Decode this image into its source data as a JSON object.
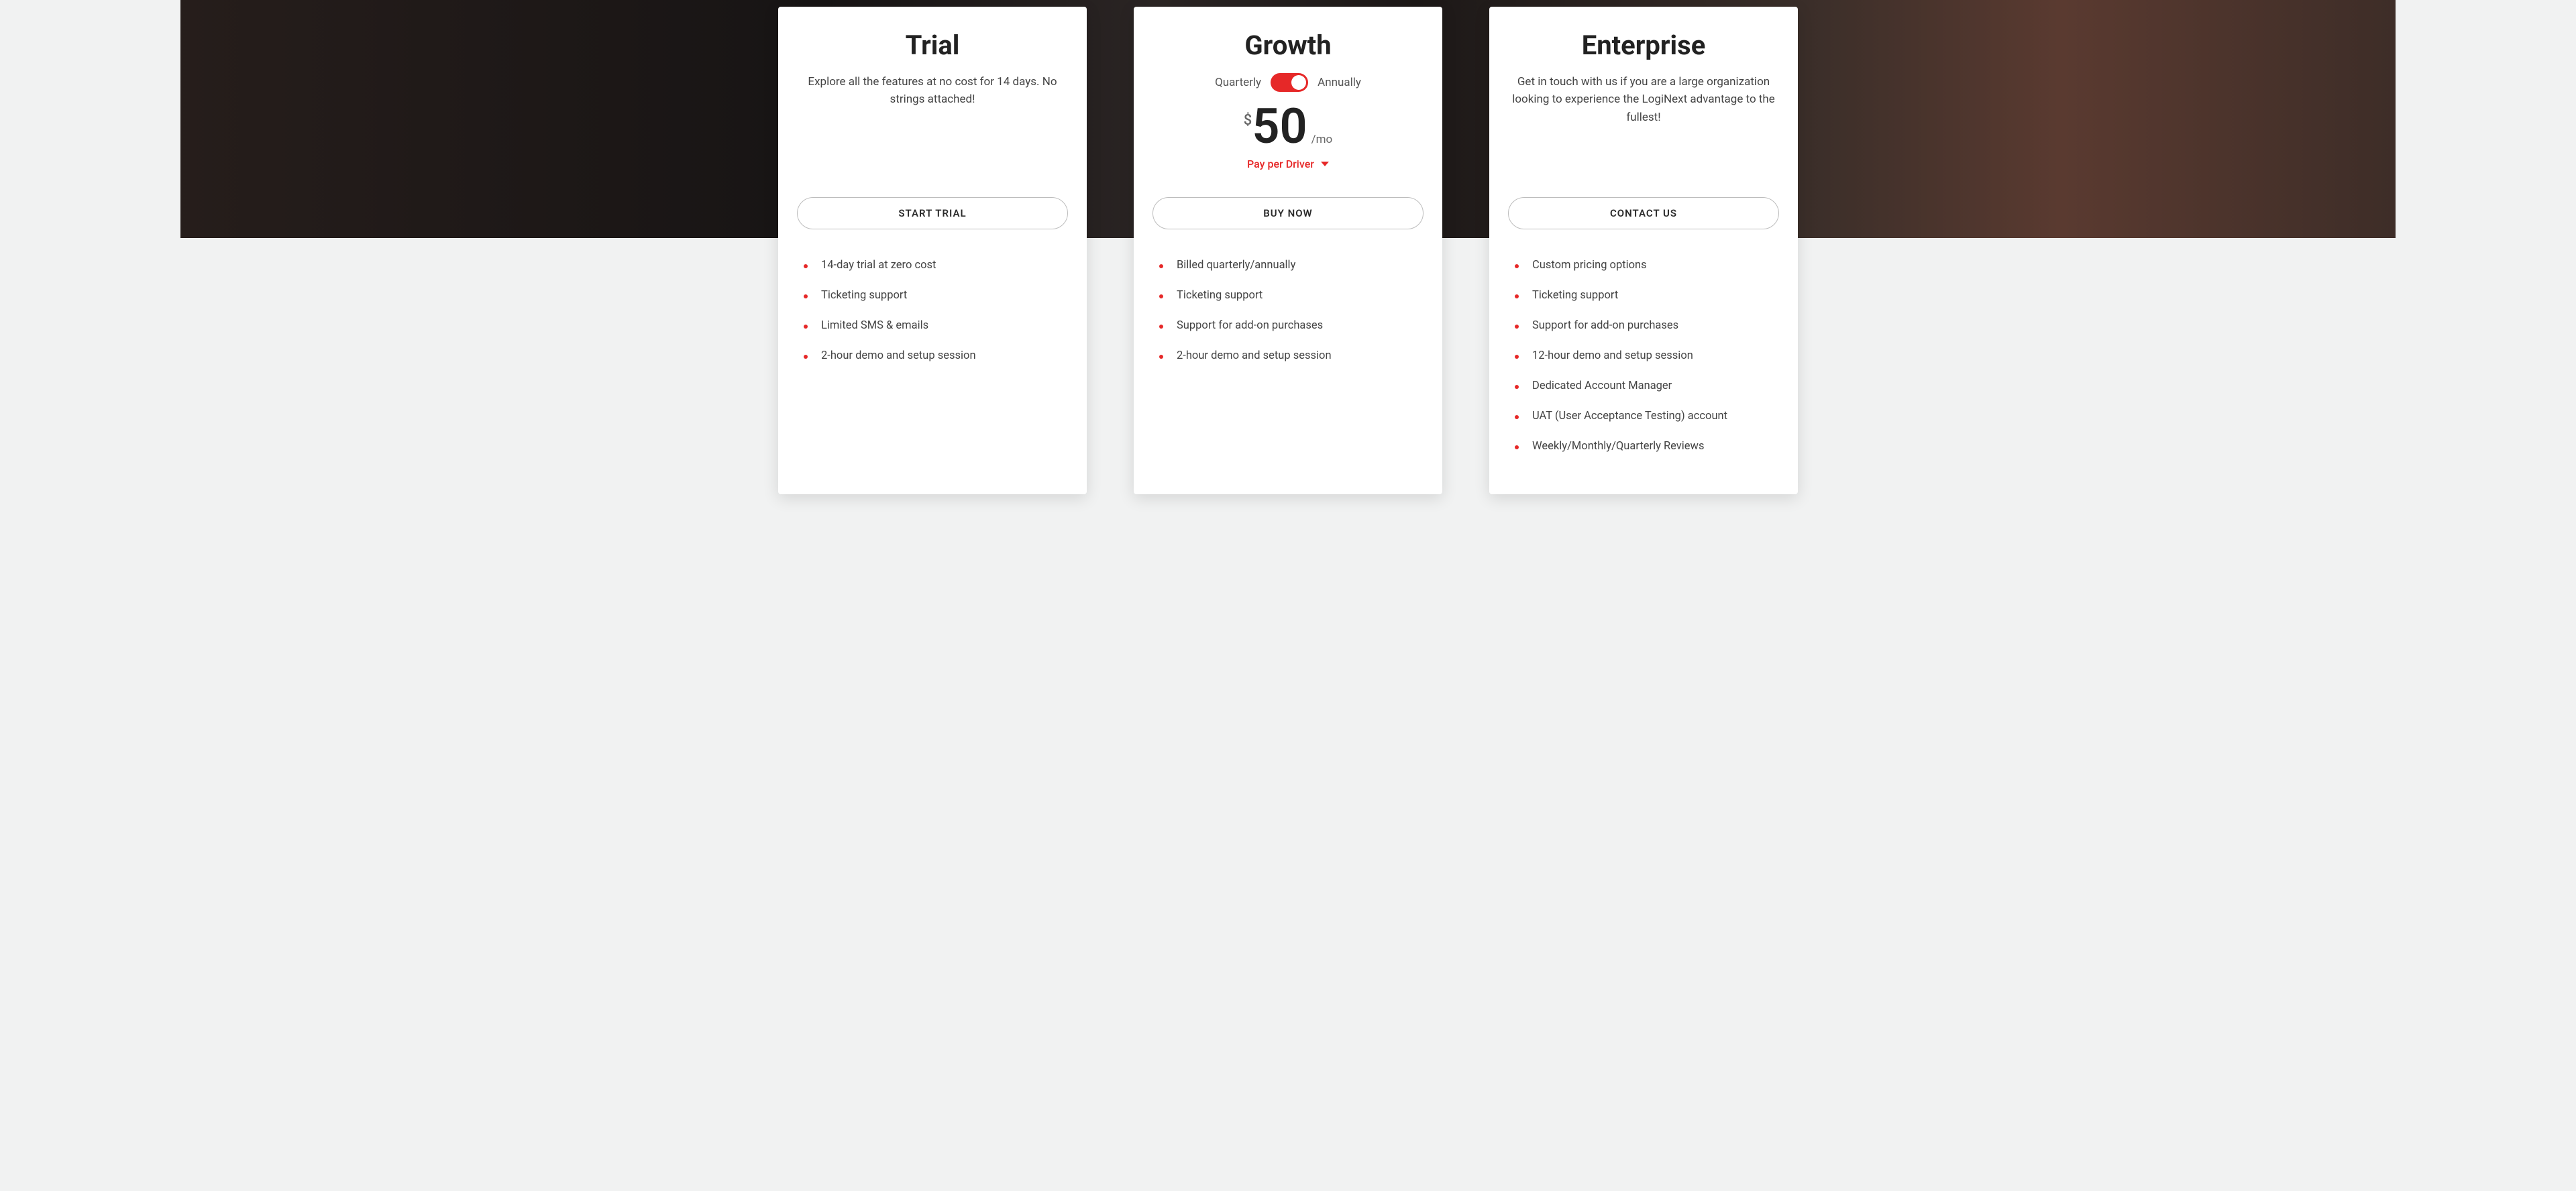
{
  "accent": "#e62828",
  "plans": {
    "trial": {
      "title": "Trial",
      "desc": "Explore all the features at no cost for 14 days. No strings attached!",
      "cta": "START TRIAL",
      "features": [
        "14-day trial at zero cost",
        "Ticketing support",
        "Limited SMS & emails",
        "2-hour demo and setup session"
      ]
    },
    "growth": {
      "title": "Growth",
      "toggle_left": "Quarterly",
      "toggle_right": "Annually",
      "toggle_state": "annually",
      "currency": "$",
      "amount": "50",
      "per": "/mo",
      "pay_per": "Pay per Driver",
      "cta": "BUY NOW",
      "features": [
        "Billed quarterly/annually",
        "Ticketing support",
        "Support for add-on purchases",
        "2-hour demo and setup session"
      ]
    },
    "enterprise": {
      "title": "Enterprise",
      "desc": "Get in touch with us if you are a large organization looking to experience the LogiNext advantage to the fullest!",
      "cta": "CONTACT US",
      "features": [
        "Custom pricing options",
        "Ticketing support",
        "Support for add-on purchases",
        "12-hour demo and setup session",
        "Dedicated Account Manager",
        "UAT (User Acceptance Testing) account",
        "Weekly/Monthly/Quarterly Reviews"
      ]
    }
  }
}
